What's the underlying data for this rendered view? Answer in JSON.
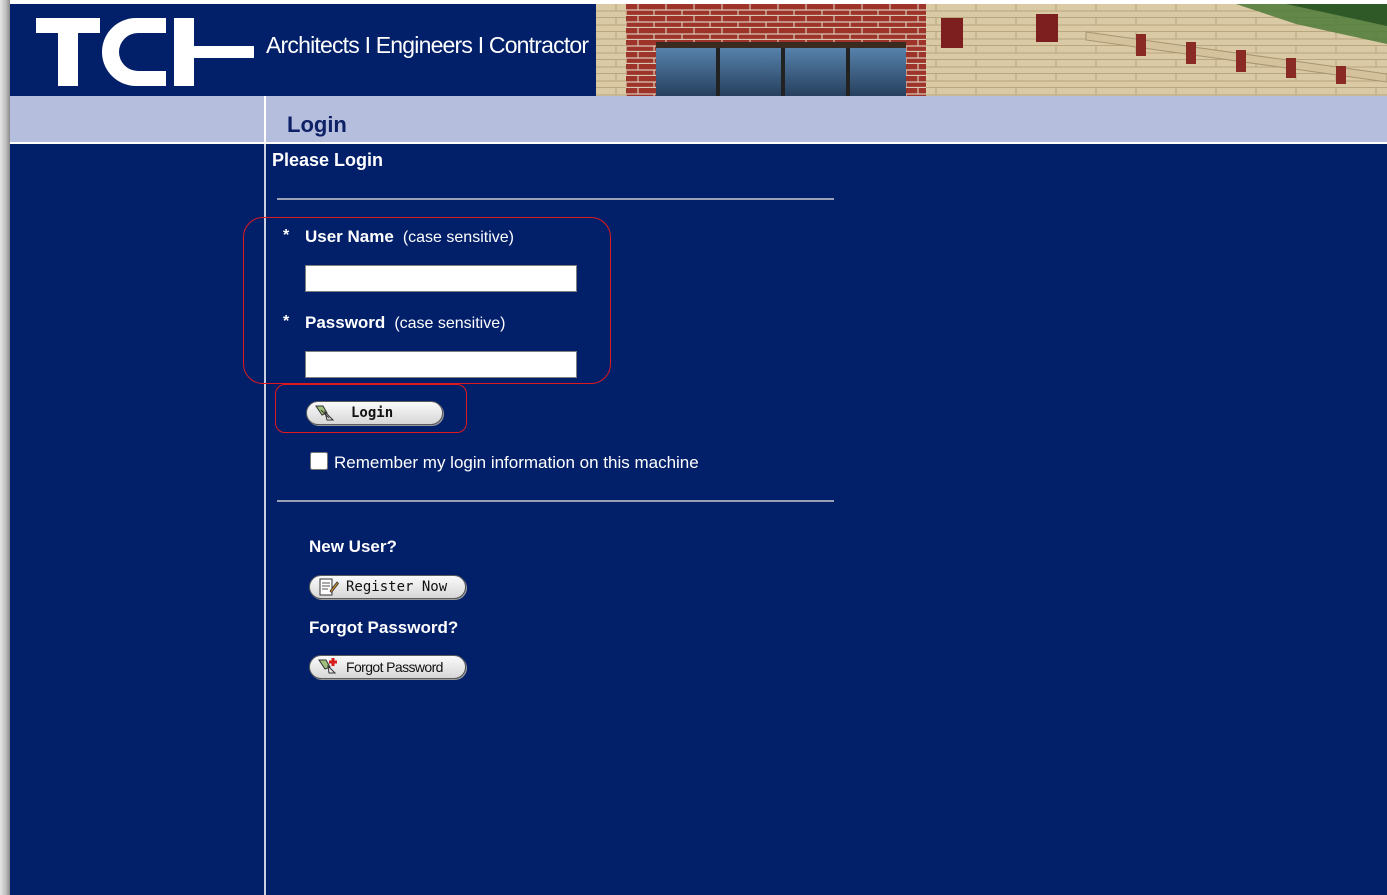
{
  "header": {
    "logo_text": "TCI",
    "tagline": "Architects I Engineers I Contractor"
  },
  "title_band": {
    "title": "Login"
  },
  "form": {
    "heading": "Please Login",
    "required_mark": "*",
    "username": {
      "label": "User Name",
      "note": "(case sensitive)",
      "value": ""
    },
    "password": {
      "label": "Password",
      "note": "(case sensitive)",
      "value": ""
    },
    "login_button": "Login",
    "remember_label": "Remember my login information on this machine",
    "remember_checked": false
  },
  "new_user": {
    "heading": "New User?",
    "register_button": "Register Now"
  },
  "forgot": {
    "heading": "Forgot Password?",
    "forgot_button": "Forgot Password"
  },
  "colors": {
    "navy": "#021f69",
    "band": "#b5bedd",
    "highlight_red": "#e0191f"
  },
  "icons": {
    "login": "login-pen-icon",
    "register": "register-document-icon",
    "forgot": "forgot-password-icon"
  }
}
